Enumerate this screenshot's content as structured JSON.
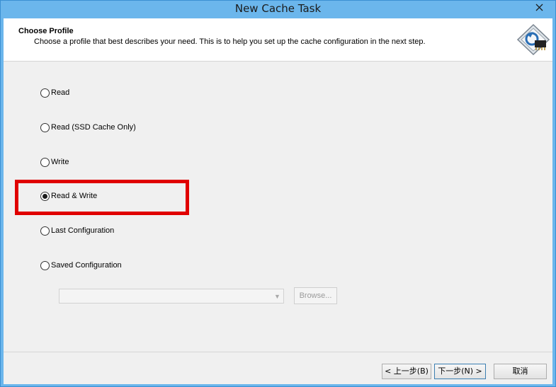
{
  "window": {
    "title": "New Cache Task"
  },
  "header": {
    "title": "Choose Profile",
    "subtitle": "Choose a profile that best describes your need. This is to help you set up the cache configuration in the next step.",
    "icon": "cache-wizard-icon"
  },
  "profiles": [
    {
      "label": "Read",
      "selected": false
    },
    {
      "label": "Read (SSD Cache Only)",
      "selected": false
    },
    {
      "label": "Write",
      "selected": false
    },
    {
      "label": "Read & Write",
      "selected": true
    },
    {
      "label": "Last Configuration",
      "selected": false
    },
    {
      "label": "Saved Configuration",
      "selected": false
    }
  ],
  "saved_config": {
    "value": "",
    "browse_label": "Browse..."
  },
  "buttons": {
    "back": "< 上一步(B)",
    "next": "下一步(N) >",
    "cancel": "取消"
  },
  "colors": {
    "titlebar": "#6bb6ec",
    "highlight": "#e00000"
  }
}
